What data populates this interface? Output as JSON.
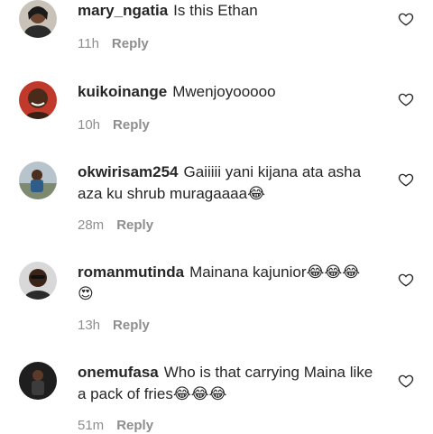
{
  "comments": [
    {
      "username": "mary_ngatia",
      "text": "Is this Ethan",
      "time": "11h",
      "reply": "Reply",
      "avatar": "avatar-woman-smiling",
      "like_icon": "heart-outline-icon"
    },
    {
      "username": "kuikoinange",
      "text": "Mwenjoyooooo",
      "time": "10h",
      "reply": "Reply",
      "avatar": "avatar-woman-red-background",
      "like_icon": "heart-outline-icon"
    },
    {
      "username": "okwirisam254",
      "text": "Gaiiiii yani kijana ata asha aza ku shrub muragaaaa😂",
      "time": "28m",
      "reply": "Reply",
      "avatar": "avatar-man-seated",
      "like_icon": "heart-outline-icon"
    },
    {
      "username": "romanmutinda",
      "text": "Mainana kajunior😂😂😂😍",
      "time": "13h",
      "reply": "Reply",
      "avatar": "avatar-man-portrait",
      "like_icon": "heart-outline-icon"
    },
    {
      "username": "onemufasa",
      "text": "Who is that carrying Maina like a pack of fries😂😂😂",
      "time": "51m",
      "reply": "Reply",
      "avatar": "avatar-man-dark",
      "like_icon": "heart-outline-icon"
    }
  ]
}
